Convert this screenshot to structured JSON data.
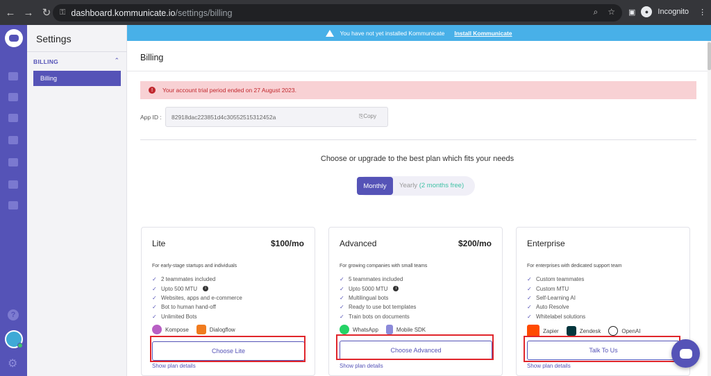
{
  "browser": {
    "url_host": "dashboard.kommunicate.io",
    "url_path": "/settings/billing",
    "profile_label": "Incognito"
  },
  "sidebar": {
    "title": "Settings",
    "section": "BILLING",
    "items": [
      {
        "label": "Billing",
        "active": true
      }
    ]
  },
  "banner": {
    "message": "You have not yet installed Kommunicate",
    "link": "Install Kommunicate"
  },
  "main": {
    "title": "Billing",
    "alert": "Your account trial period ended on 27 August 2023.",
    "app_id_label": "App ID :",
    "app_id_value": "82918dac223851d4c30552515312452a",
    "copy_label": "Copy",
    "choose_text": "Choose or upgrade to the best plan which fits your needs",
    "toggle": {
      "monthly": "Monthly",
      "yearly": "Yearly",
      "yearly_note": "(2 months free)",
      "selected": "Monthly"
    }
  },
  "plans": [
    {
      "name": "Lite",
      "price": "$100/mo",
      "description": "For early-stage startups and individuals",
      "features": [
        "2 teammates included",
        "Upto 500 MTU",
        "Websites, apps and e-commerce",
        "Bot to human hand-off",
        "Unlimited Bots"
      ],
      "integrations": [
        "Kompose",
        "Dialogflow"
      ],
      "cta": "Choose Lite",
      "details": "Show plan details"
    },
    {
      "name": "Advanced",
      "price": "$200/mo",
      "description": "For growing companies with small teams",
      "features": [
        "5 teammates included",
        "Upto 5000 MTU",
        "Multilingual bots",
        "Ready to use bot templates",
        "Train bots on documents"
      ],
      "integrations": [
        "WhatsApp",
        "Mobile SDK"
      ],
      "cta": "Choose Advanced",
      "details": "Show plan details"
    },
    {
      "name": "Enterprise",
      "price": "",
      "description": "For enterprises with dedicated support team",
      "features": [
        "Custom teammates",
        "Custom MTU",
        "Self-Learning AI",
        "Auto Resolve",
        "Whitelabel solutions"
      ],
      "integrations": [
        "Zapier",
        "Zendesk",
        "OpenAI"
      ],
      "cta": "Talk To Us",
      "details": "Show plan details"
    }
  ],
  "colors": {
    "brand": "#5553b7",
    "banner": "#48b0e8",
    "alert_bg": "#f8d1d4",
    "alert_text": "#c0272d",
    "highlight": "#e0252b"
  }
}
